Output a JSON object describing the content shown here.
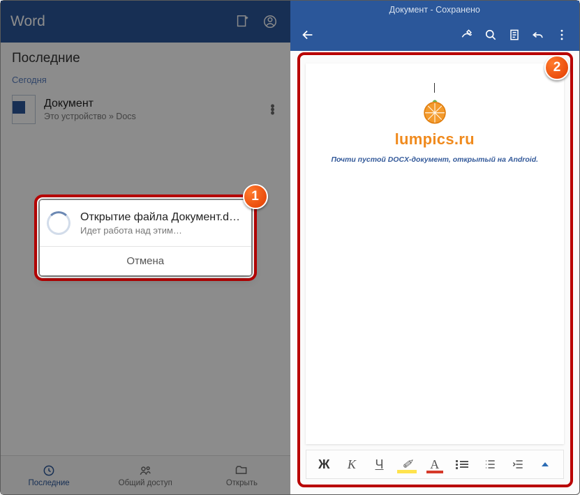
{
  "left": {
    "app_title": "Word",
    "section": "Последние",
    "day_label": "Сегодня",
    "doc": {
      "name": "Документ",
      "path": "Это устройство » Docs"
    },
    "dialog": {
      "title": "Открытие файла Документ.docx…",
      "subtitle": "Идет работа над этим…",
      "cancel": "Отмена"
    },
    "tabs": {
      "recent": "Последние",
      "shared": "Общий доступ",
      "open": "Открыть"
    }
  },
  "right": {
    "titlebar": "Документ - Сохранено",
    "brand": "lumpics.ru",
    "caption": "Почти пустой DOCX-документ, открытый на Android.",
    "format": {
      "bold": "Ж",
      "italic": "К",
      "underline": "Ч",
      "highlight": "✐",
      "font": "A"
    }
  },
  "badges": {
    "one": "1",
    "two": "2"
  }
}
